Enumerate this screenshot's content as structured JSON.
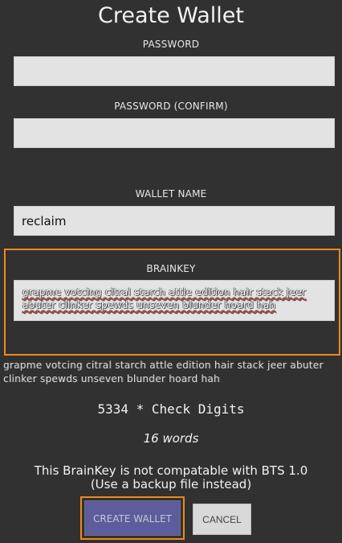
{
  "title": "Create Wallet",
  "password": {
    "label": "PASSWORD",
    "value": ""
  },
  "password_confirm": {
    "label": "PASSWORD (CONFIRM)",
    "value": ""
  },
  "wallet_name": {
    "label": "WALLET NAME",
    "value": "reclaim"
  },
  "brainkey": {
    "label": "BRAINKEY",
    "field_text": "grapme votcing citral starch attle edition hair stack jeer abuter clinker spewds unseven blunder hoard hah",
    "preview_text": "grapme votcing citral starch attle edition hair stack jeer abuter clinker spewds unseven blunder hoard hah"
  },
  "check_digits": "5334 * Check Digits",
  "word_count": "16 words",
  "warning_line1": "This BrainKey is not compatable with BTS 1.0",
  "warning_line2": "(Use a backup file instead)",
  "buttons": {
    "create": "CREATE WALLET",
    "cancel": "CANCEL"
  },
  "colors": {
    "background": "#313131",
    "highlight": "#ef8a1b",
    "create_button": "#5d5c9c"
  }
}
